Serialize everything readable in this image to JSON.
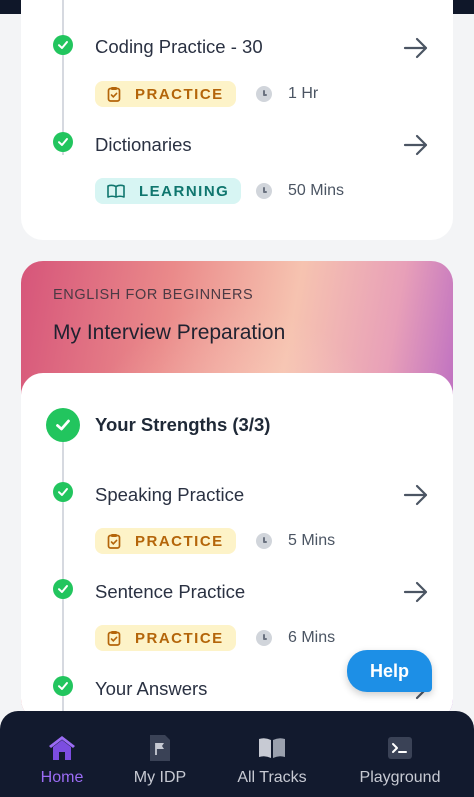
{
  "top_card": {
    "items": [
      {
        "title": "Coding Practice - 30",
        "badge": "PRACTICE",
        "duration": "1 Hr"
      },
      {
        "title": "Dictionaries",
        "badge": "LEARNING",
        "duration": "50 Mins"
      }
    ]
  },
  "idp_card": {
    "eyebrow": "ENGLISH FOR BEGINNERS",
    "title": "My Interview Preparation",
    "section_title": "Your Strengths (3/3)",
    "items": [
      {
        "title": "Speaking Practice",
        "badge": "PRACTICE",
        "duration": "5 Mins"
      },
      {
        "title": "Sentence Practice",
        "badge": "PRACTICE",
        "duration": "6 Mins"
      },
      {
        "title": "Your Answers"
      }
    ]
  },
  "help_button": {
    "label": "Help"
  },
  "bottom_nav": {
    "items": [
      {
        "label": "Home",
        "icon": "home-icon",
        "active": true
      },
      {
        "label": "My IDP",
        "icon": "flag-document-icon",
        "active": false
      },
      {
        "label": "All Tracks",
        "icon": "book-open-icon",
        "active": false
      },
      {
        "label": "Playground",
        "icon": "terminal-icon",
        "active": false
      }
    ]
  },
  "colors": {
    "check_green": "#22c55e",
    "practice_bg": "#fdf3c8",
    "practice_text": "#b4650a",
    "learning_bg": "#d7f5f3",
    "learning_text": "#0f766e",
    "help_blue": "#1d8fe6",
    "nav_bg": "#121a2e",
    "nav_active": "#9b6cf5"
  }
}
